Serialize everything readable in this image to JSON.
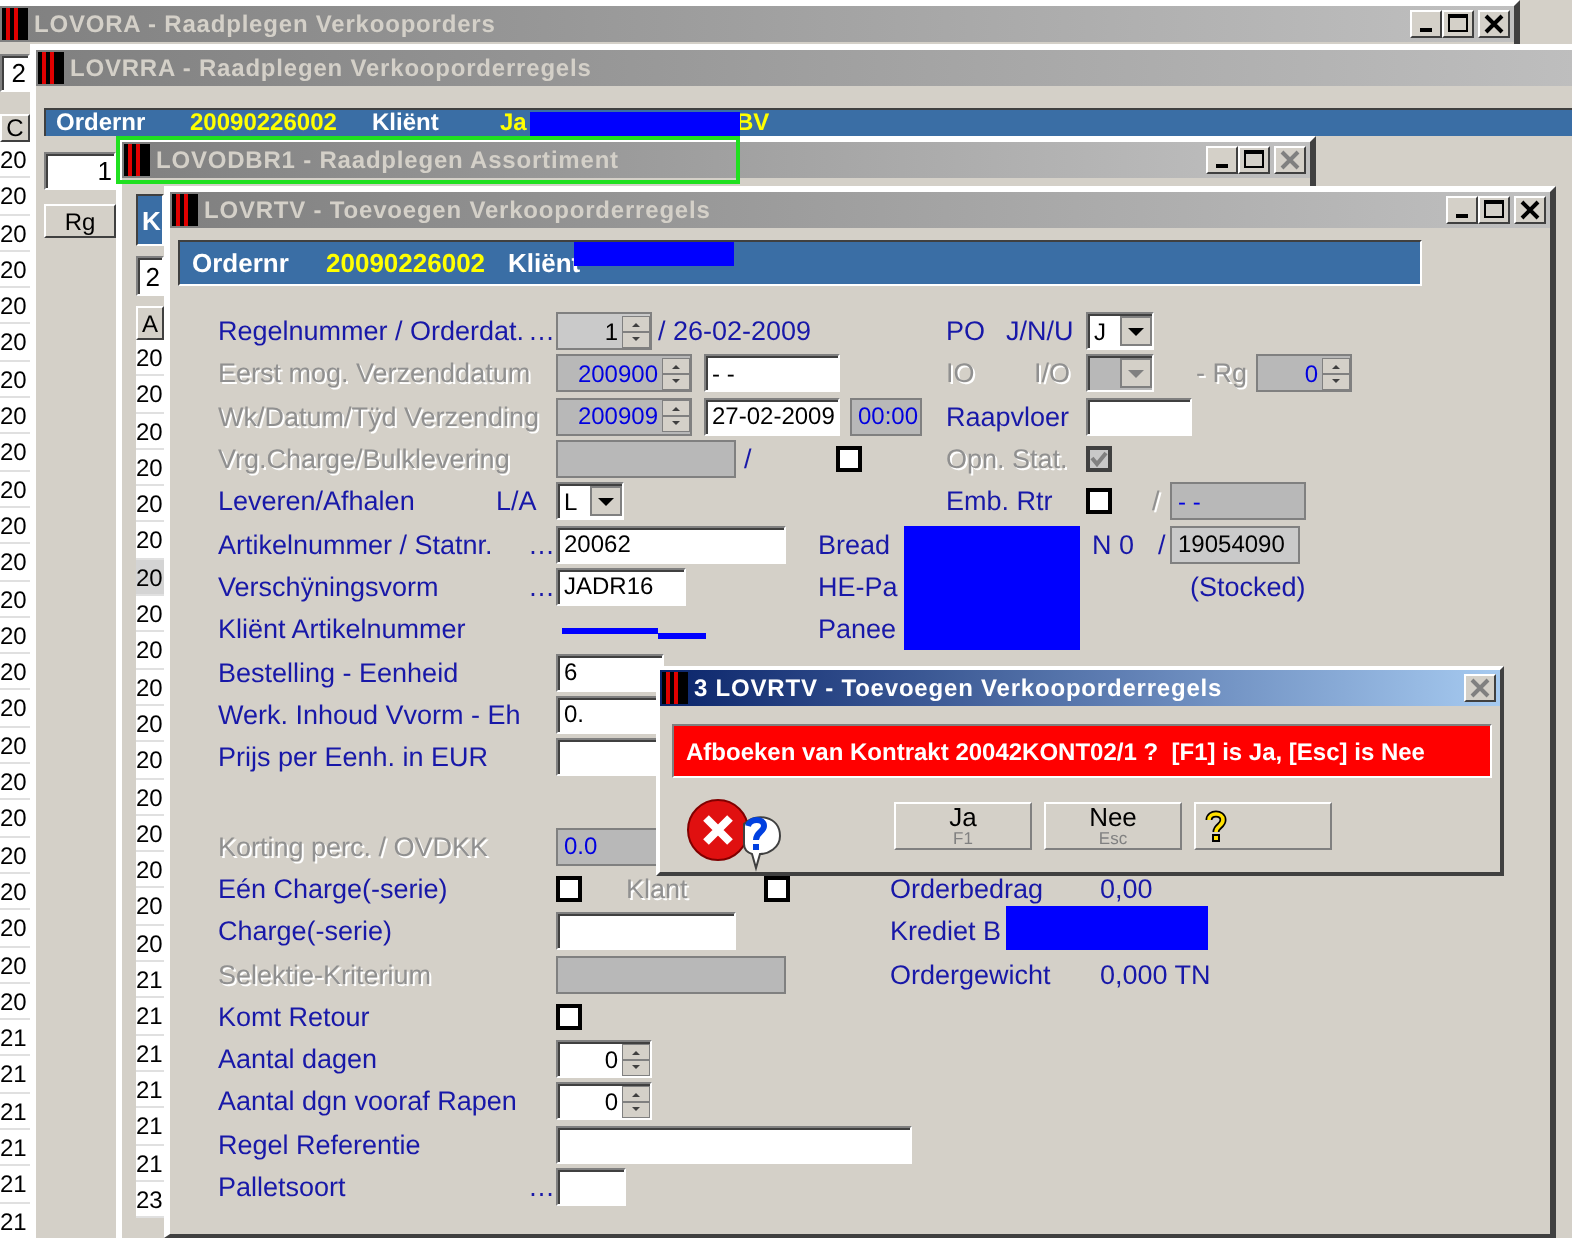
{
  "windows": [
    {
      "kind": "list",
      "title": "LOVORA - Raadplegen Verkooporders",
      "active": false,
      "close_disabled": false,
      "field": "2",
      "column_header": "C",
      "rows": [
        "20",
        "20",
        "20",
        "20",
        "20",
        "20",
        "20",
        "20",
        "20",
        "20",
        "20",
        "20",
        "20",
        "20",
        "20",
        "20",
        "20",
        "20",
        "20",
        "20",
        "20",
        "20",
        "20",
        "20",
        "21",
        "21",
        "21",
        "21",
        "21",
        "21"
      ]
    },
    {
      "kind": "list",
      "title": "LOVRRA - Raadplegen Verkooporderregels",
      "active": false,
      "header": [
        {
          "kind": "label",
          "text": "Ordernr"
        },
        {
          "kind": "value",
          "text": "20090226002"
        },
        {
          "kind": "label",
          "text": "Kliënt"
        },
        {
          "kind": "value",
          "text": "Ja"
        },
        {
          "kind": "value",
          "text": "BV"
        }
      ],
      "field": "1",
      "column_header": "Rg"
    },
    {
      "kind": "list",
      "title": "LOVODBR1 - Raadplegen Assortiment",
      "active": false,
      "close_disabled": true,
      "header": [
        {
          "kind": "label",
          "text": "K"
        }
      ],
      "field": "2",
      "column_header": "A",
      "rows": [
        {
          "text": "20",
          "selected": false
        },
        {
          "text": "20",
          "selected": false
        },
        {
          "text": "20",
          "selected": false
        },
        {
          "text": "20",
          "selected": false
        },
        {
          "text": "20",
          "selected": false
        },
        {
          "text": "20",
          "selected": false
        },
        {
          "text": "20",
          "selected": true
        },
        {
          "text": "20",
          "selected": false
        },
        {
          "text": "20",
          "selected": false
        },
        {
          "text": "20",
          "selected": false
        },
        {
          "text": "20",
          "selected": false
        },
        {
          "text": "20",
          "selected": false
        },
        {
          "text": "20",
          "selected": false
        },
        {
          "text": "20",
          "selected": false
        },
        {
          "text": "20",
          "selected": false
        },
        {
          "text": "20",
          "selected": false
        },
        {
          "text": "20",
          "selected": false
        },
        {
          "text": "21",
          "selected": false
        },
        {
          "text": "21",
          "selected": false
        },
        {
          "text": "21",
          "selected": false
        },
        {
          "text": "21",
          "selected": false
        },
        {
          "text": "21",
          "selected": false
        },
        {
          "text": "21",
          "selected": false
        },
        {
          "text": "23",
          "selected": false
        }
      ]
    },
    {
      "kind": "form",
      "title": "LOVRTV - Toevoegen Verkooporderregels",
      "active": false,
      "close_disabled": false,
      "header": [
        {
          "kind": "label",
          "text": "Ordernr"
        },
        {
          "kind": "value",
          "text": "20090226002"
        },
        {
          "kind": "label",
          "text": "Kliënt"
        }
      ],
      "form": [
        {
          "items": [
            {
              "kind": "label",
              "text": "Regelnummer / Orderdat.",
              "disabled": false
            },
            {
              "kind": "label",
              "text": "…",
              "disabled": false
            },
            {
              "kind": "spin",
              "value": "1",
              "disabled": false,
              "readonly": true
            },
            {
              "kind": "label",
              "text": "/ 26-02-2009",
              "disabled": false
            },
            {
              "kind": "label",
              "text": "PO",
              "disabled": false
            },
            {
              "kind": "label",
              "text": "J/N/U",
              "disabled": false
            },
            {
              "kind": "combo",
              "value": "J",
              "disabled": false
            }
          ]
        },
        {
          "items": [
            {
              "kind": "label",
              "text": "Eerst mog. Verzenddatum",
              "disabled": true
            },
            {
              "kind": "spin",
              "value": "200900",
              "disabled": true,
              "readonly": true
            },
            {
              "kind": "field",
              "value": "- -",
              "disabled": false,
              "readonly": false
            },
            {
              "kind": "label",
              "text": "IO",
              "disabled": true
            },
            {
              "kind": "label",
              "text": "I/O",
              "disabled": true
            },
            {
              "kind": "combo",
              "disabled": true
            },
            {
              "kind": "label",
              "text": "- Rg",
              "disabled": true
            },
            {
              "kind": "spin",
              "value": "0",
              "disabled": true,
              "readonly": true
            }
          ]
        },
        {
          "items": [
            {
              "kind": "label",
              "text": "Wk/Datum/Tÿd Verzending",
              "disabled": true
            },
            {
              "kind": "spin",
              "value": "200909",
              "disabled": true,
              "readonly": true
            },
            {
              "kind": "field",
              "value": "27-02-2009",
              "disabled": false,
              "readonly": false
            },
            {
              "kind": "field",
              "value": "00:00",
              "disabled": true,
              "readonly": true
            },
            {
              "kind": "label",
              "text": "Raapvloer",
              "disabled": false
            },
            {
              "kind": "field",
              "disabled": false,
              "readonly": false
            }
          ]
        },
        {
          "items": [
            {
              "kind": "label",
              "text": "Vrg.Charge/Bulklevering",
              "disabled": true
            },
            {
              "kind": "field",
              "disabled": true,
              "readonly": true
            },
            {
              "kind": "label",
              "text": "/",
              "disabled": false
            },
            {
              "kind": "checkbox",
              "checked": false,
              "disabled": false
            },
            {
              "kind": "label",
              "text": "Opn. Stat.",
              "disabled": true
            },
            {
              "kind": "checkbox",
              "checked": true,
              "disabled": true
            }
          ]
        },
        {
          "items": [
            {
              "kind": "label",
              "text": "Leveren/Afhalen",
              "disabled": false
            },
            {
              "kind": "label",
              "text": "L/A",
              "disabled": false
            },
            {
              "kind": "combo",
              "value": "L",
              "disabled": false
            },
            {
              "kind": "label",
              "text": "Emb. Rtr",
              "disabled": false
            },
            {
              "kind": "checkbox",
              "checked": false,
              "disabled": false
            },
            {
              "kind": "label",
              "text": "/",
              "disabled": true
            },
            {
              "kind": "field",
              "value": "- -",
              "disabled": true,
              "readonly": true
            }
          ]
        },
        {
          "items": [
            {
              "kind": "label",
              "text": "Artikelnummer / Statnr.",
              "disabled": false
            },
            {
              "kind": "label",
              "text": "…",
              "disabled": false
            },
            {
              "kind": "field",
              "value": "20062",
              "disabled": false,
              "readonly": false
            },
            {
              "kind": "label",
              "text": "Bread",
              "disabled": false
            },
            {
              "kind": "label",
              "text": "N 0",
              "disabled": false
            },
            {
              "kind": "label",
              "text": "/",
              "disabled": false
            },
            {
              "kind": "field",
              "value": "19054090",
              "disabled": false,
              "readonly": true
            }
          ]
        },
        {
          "items": [
            {
              "kind": "label",
              "text": "Verschÿningsvorm",
              "disabled": false
            },
            {
              "kind": "label",
              "text": "…",
              "disabled": false
            },
            {
              "kind": "field",
              "value": "JADR16",
              "disabled": false,
              "readonly": false
            },
            {
              "kind": "label",
              "text": "HE-Pa",
              "disabled": false
            },
            {
              "kind": "label",
              "text": "(Stocked)",
              "disabled": false
            }
          ]
        },
        {
          "items": [
            {
              "kind": "label",
              "text": "Kliënt Artikelnummer",
              "disabled": false
            },
            {
              "kind": "label",
              "text": "Panee",
              "disabled": false
            }
          ]
        },
        {
          "items": [
            {
              "kind": "label",
              "text": "Bestelling - Eenheid",
              "disabled": false
            },
            {
              "kind": "field",
              "value": "6",
              "disabled": false,
              "readonly": false
            }
          ]
        },
        {
          "items": [
            {
              "kind": "label",
              "text": "Werk. Inhoud Vvorm - Eh",
              "disabled": false
            },
            {
              "kind": "field",
              "value": "0.",
              "disabled": false,
              "readonly": false
            }
          ]
        },
        {
          "items": [
            {
              "kind": "label",
              "text": "Prijs per Eenh. in EUR",
              "disabled": false
            },
            {
              "kind": "field",
              "disabled": false,
              "readonly": false
            }
          ]
        },
        {
          "items": [
            {
              "kind": "label",
              "text": "Korting perc. / OVDKK",
              "disabled": true
            },
            {
              "kind": "field",
              "value": "0.0",
              "disabled": true,
              "readonly": true
            }
          ]
        },
        {
          "items": [
            {
              "kind": "label",
              "text": "Eén Charge(-serie)",
              "disabled": false
            },
            {
              "kind": "checkbox",
              "checked": false,
              "disabled": false
            },
            {
              "kind": "label",
              "text": "Klant",
              "disabled": true
            },
            {
              "kind": "checkbox",
              "checked": false,
              "disabled": false
            },
            {
              "kind": "label",
              "text": "Orderbedrag",
              "disabled": false
            },
            {
              "kind": "label",
              "text": "0,00",
              "disabled": false
            }
          ]
        },
        {
          "items": [
            {
              "kind": "label",
              "text": "Charge(-serie)",
              "disabled": false
            },
            {
              "kind": "field",
              "disabled": false,
              "readonly": false
            },
            {
              "kind": "label",
              "text": "Krediet B",
              "disabled": false
            }
          ]
        },
        {
          "items": [
            {
              "kind": "label",
              "text": "Selektie-Kriterium",
              "disabled": true
            },
            {
              "kind": "field",
              "disabled": true,
              "readonly": true
            },
            {
              "kind": "label",
              "text": "Ordergewicht",
              "disabled": false
            },
            {
              "kind": "label",
              "text": "0,000 TN",
              "disabled": false
            }
          ]
        },
        {
          "items": [
            {
              "kind": "label",
              "text": "Komt Retour",
              "disabled": false
            },
            {
              "kind": "checkbox",
              "checked": false,
              "disabled": false
            }
          ]
        },
        {
          "items": [
            {
              "kind": "label",
              "text": "Aantal dagen",
              "disabled": false
            },
            {
              "kind": "spin",
              "value": "0",
              "disabled": false,
              "readonly": false
            }
          ]
        },
        {
          "items": [
            {
              "kind": "label",
              "text": "Aantal dgn vooraf Rapen",
              "disabled": false
            },
            {
              "kind": "spin",
              "value": "0",
              "disabled": false,
              "readonly": false
            }
          ]
        },
        {
          "items": [
            {
              "kind": "label",
              "text": "Regel Referentie",
              "disabled": false
            },
            {
              "kind": "field",
              "disabled": false,
              "readonly": false
            }
          ]
        },
        {
          "items": [
            {
              "kind": "label",
              "text": "Palletsoort",
              "disabled": false
            },
            {
              "kind": "label",
              "text": "…",
              "disabled": false
            },
            {
              "kind": "field",
              "disabled": false,
              "readonly": false
            }
          ]
        }
      ]
    }
  ],
  "dialog": {
    "title": "3 LOVRTV - Toevoegen Verkooporderregels",
    "active": true,
    "close_disabled": true,
    "message": "Afboeken van Kontrakt 20042KONT02/1 ?  [F1] is Ja, [Esc] is Nee",
    "buttons": [
      {
        "kind": "answer",
        "label": "Ja",
        "key": "F1"
      },
      {
        "kind": "answer",
        "label": "Nee",
        "key": "Esc"
      },
      {
        "kind": "help"
      }
    ]
  }
}
